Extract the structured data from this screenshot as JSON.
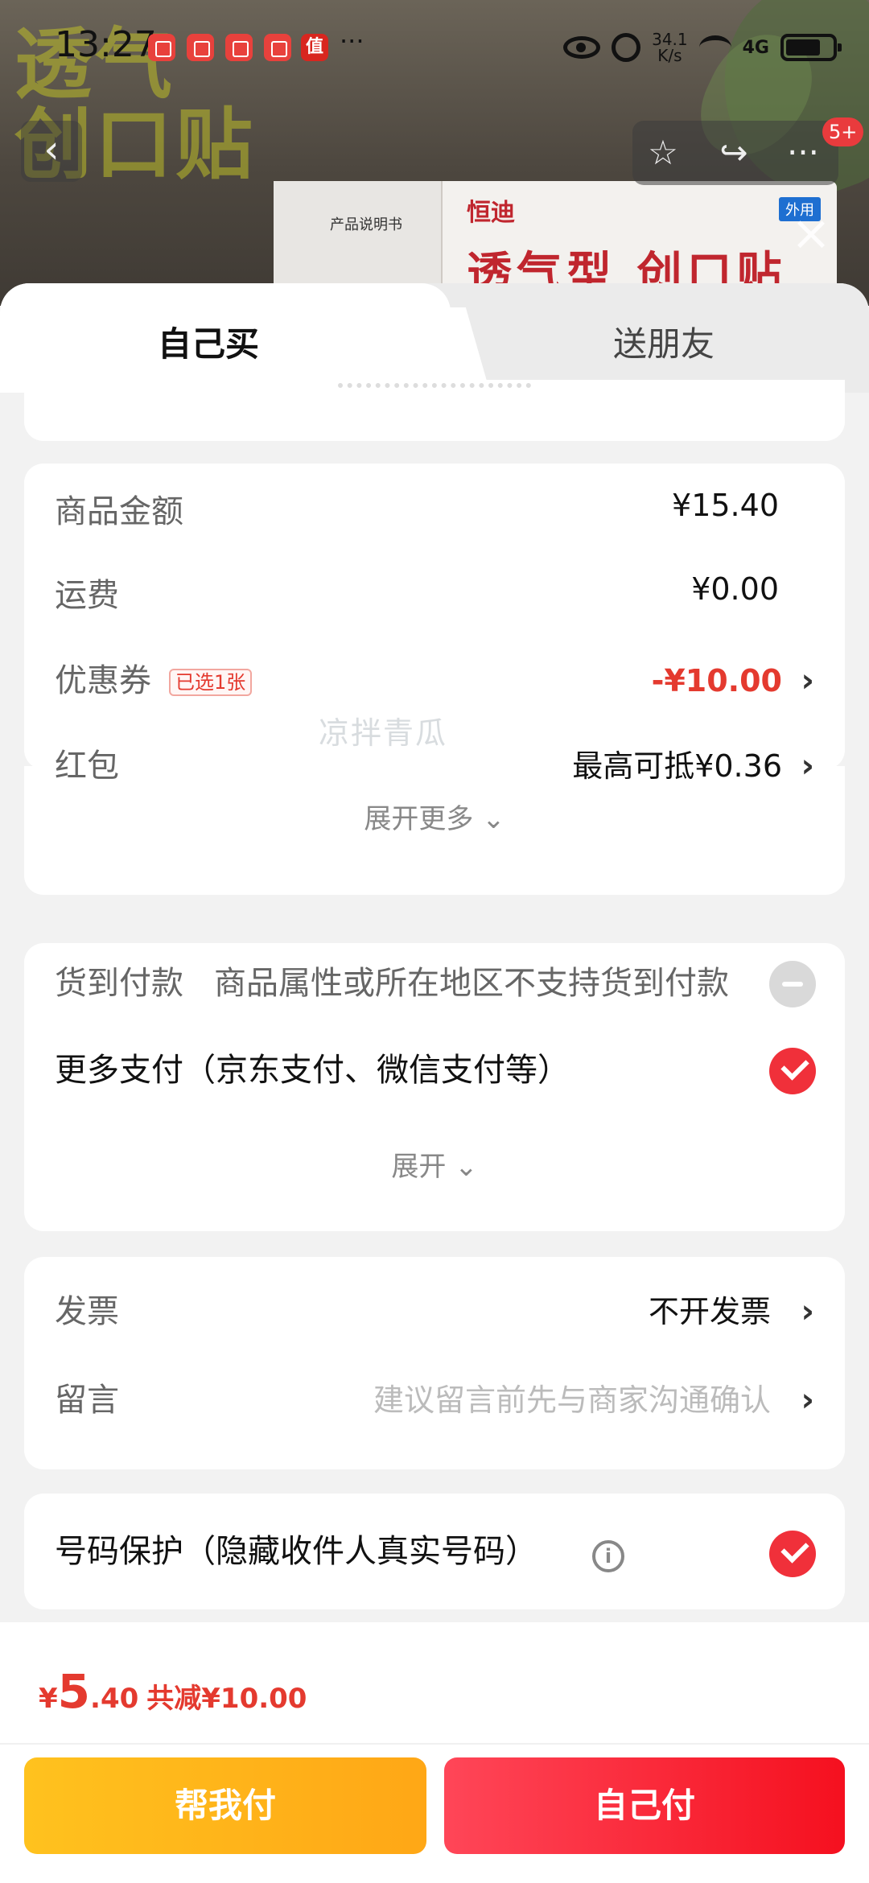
{
  "status_bar": {
    "time": "13:27",
    "dots": "···",
    "net_speed_top": "34.1",
    "net_speed_bottom": "K/s",
    "net_type": "4G",
    "signal_sup": "6"
  },
  "app_icons": [
    "app",
    "app",
    "app",
    "app"
  ],
  "app_zhi": "值",
  "backdrop": {
    "big_line1": "透气",
    "big_line2": "创口贴",
    "box_brand": "恒迪",
    "box_title": "透气型 创口贴",
    "box_tag": "外用",
    "box_side": "产品说明书"
  },
  "nav": {
    "back": "‹",
    "star": "☆",
    "share": "↪",
    "more": "···",
    "badge": "5+",
    "close": "×"
  },
  "tabs": {
    "self": "自己买",
    "friend": "送朋友"
  },
  "amounts": {
    "goods_label": "商品金额",
    "goods_value": "¥15.40",
    "shipping_label": "运费",
    "shipping_value": "¥0.00",
    "coupon_label": "优惠券",
    "coupon_tag": "已选1张",
    "coupon_value": "-¥10.00",
    "redpacket_label": "红包",
    "redpacket_value": "最高可抵¥0.36",
    "expand_more": "展开更多 ⌄",
    "arrow": "›"
  },
  "watermark": "凉拌青瓜",
  "payment": {
    "cod_label": "货到付款",
    "cod_hint": "商品属性或所在地区不支持货到付款",
    "more_label": "更多支付（京东支付、微信支付等）",
    "expand": "展开 ⌄"
  },
  "extras": {
    "invoice_label": "发票",
    "invoice_value": "不开发票",
    "message_label": "留言",
    "message_placeholder": "建议留言前先与商家沟通确认"
  },
  "privacy": {
    "label": "号码保护（隐藏收件人真实号码）",
    "info": "i"
  },
  "footer": {
    "currency": "¥",
    "price_int": "5",
    "price_dec": ".40",
    "savings": "共减¥10.00",
    "help_pay": "帮我付",
    "self_pay": "自己付"
  },
  "colors": {
    "accent_red": "#f0303a",
    "price_red": "#e43a2f",
    "help_yellow": "#ffb81a"
  }
}
